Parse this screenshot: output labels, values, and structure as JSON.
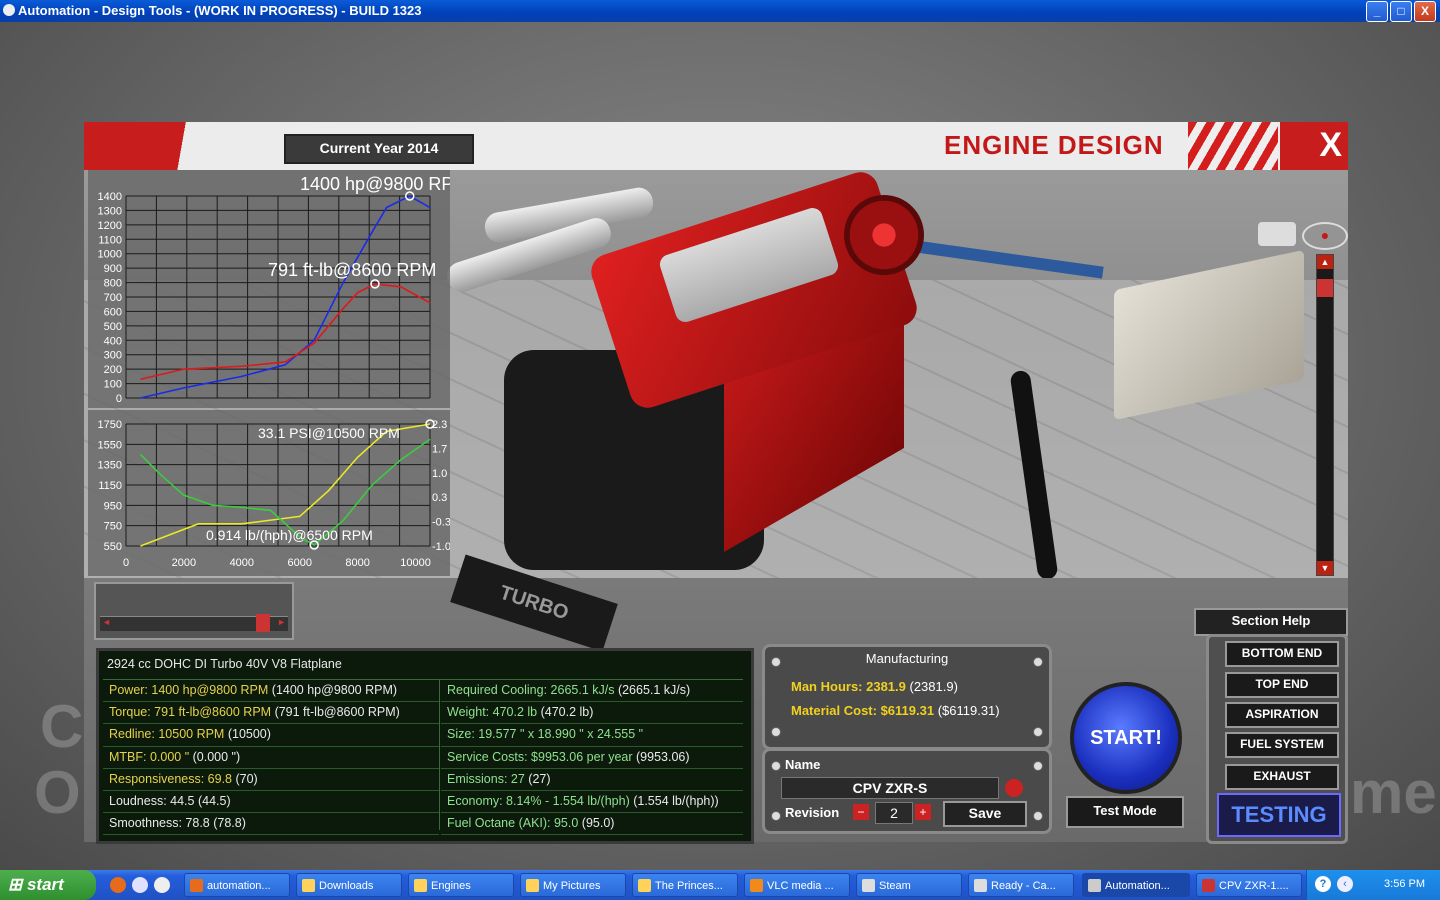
{
  "window": {
    "title": "Automation - Design Tools - (WORK IN PROGRESS) - BUILD 1323",
    "min": "_",
    "max": "□",
    "close": "X"
  },
  "background_text": {
    "left_top": "C",
    "left_bottom": "O",
    "right": "me"
  },
  "header": {
    "year": "Current Year 2014",
    "title": "ENGINE DESIGN",
    "close": "X"
  },
  "viewport_decor": {
    "turbo_label": "TURBO"
  },
  "chart_data": [
    {
      "type": "line",
      "title": "",
      "annotations": [
        "1400 hp@9800 RPM",
        "791 ft-lb@8600 RPM"
      ],
      "y_ticks": [
        "1400",
        "1300",
        "1200",
        "1100",
        "1000",
        "900",
        "800",
        "700",
        "600",
        "500",
        "400",
        "300",
        "200",
        "100",
        "0"
      ],
      "ylim": [
        0,
        1400
      ],
      "xlim": [
        0,
        10500
      ],
      "series": [
        {
          "color": "#1a2be8",
          "x": [
            500,
            2000,
            4000,
            5500,
            6500,
            7500,
            8500,
            9000,
            9800,
            10500
          ],
          "y": [
            0,
            70,
            150,
            230,
            400,
            800,
            1150,
            1320,
            1400,
            1320
          ]
        },
        {
          "color": "#e01818",
          "x": [
            500,
            2000,
            4000,
            5500,
            6500,
            7500,
            8000,
            8600,
            9500,
            10500
          ],
          "y": [
            130,
            200,
            220,
            250,
            380,
            620,
            730,
            791,
            770,
            660
          ]
        }
      ]
    },
    {
      "type": "line",
      "title": "",
      "annotations": [
        "33.1 PSI@10500 RPM",
        "0.914 lb/(hph)@6500 RPM"
      ],
      "y_left_ticks": [
        "1750",
        "1550",
        "1350",
        "1150",
        "950",
        "750",
        "550"
      ],
      "y_right_ticks": [
        "2.3",
        "1.7",
        "1.0",
        "0.3",
        "-0.3",
        "-1.0"
      ],
      "x_ticks": [
        "0",
        "2000",
        "4000",
        "6000",
        "8000",
        "10000"
      ],
      "ylim": [
        550,
        1750
      ],
      "ylim_right": [
        -1.0,
        2.3
      ],
      "xlim": [
        0,
        10500
      ],
      "series": [
        {
          "color": "#e8e82a",
          "axis": "right",
          "x": [
            500,
            1500,
            2500,
            4000,
            5000,
            6000,
            7000,
            8000,
            9000,
            10500
          ],
          "y": [
            -1.0,
            -0.7,
            -0.4,
            -0.4,
            -0.3,
            -0.2,
            0.5,
            1.4,
            2.1,
            2.3
          ]
        },
        {
          "color": "#3ccc3c",
          "axis": "left",
          "x": [
            500,
            1200,
            2000,
            3000,
            4000,
            5000,
            6000,
            6500,
            7500,
            8500,
            9500,
            10500
          ],
          "y": [
            1450,
            1250,
            1050,
            950,
            930,
            900,
            640,
            560,
            800,
            1150,
            1400,
            1600
          ]
        }
      ]
    }
  ],
  "slider": {
    "left": "◄",
    "right": "►"
  },
  "section_help": "Section Help",
  "stats": {
    "header": "2924 cc DOHC DI Turbo 40V V8 Flatplane",
    "left": [
      {
        "k": "Power: 1400 hp@9800 RPM",
        "p": " (1400 hp@9800 RPM)",
        "style": "gold"
      },
      {
        "k": "Torque: 791 ft-lb@8600 RPM",
        "p": " (791 ft-lb@8600 RPM)",
        "style": "gold"
      },
      {
        "k": "Redline: 10500 RPM",
        "p": " (10500)",
        "style": "gold"
      },
      {
        "k": "MTBF: 0.000 \"",
        "p": " (0.000 \")",
        "style": "gold"
      },
      {
        "k": "Responsiveness: 69.8",
        "p": " (70)",
        "style": "gold"
      },
      {
        "k": "Loudness: 44.5",
        "p": " (44.5)",
        "style": "w"
      },
      {
        "k": "Smoothness: 78.8",
        "p": " (78.8)",
        "style": "w"
      }
    ],
    "right": [
      {
        "k": "Required Cooling: 2665.1 kJ/s",
        "p": " (2665.1 kJ/s)",
        "style": "g"
      },
      {
        "k": "Weight: 470.2 lb",
        "p": " (470.2 lb)",
        "style": "g"
      },
      {
        "k": "Size: 19.577 \" x 18.990 \" x 24.555 \"",
        "p": "",
        "style": "g"
      },
      {
        "k": "Service Costs: $9953.06 per year",
        "p": " (9953.06)",
        "style": "g"
      },
      {
        "k": "Emissions: 27",
        "p": " (27)",
        "style": "g"
      },
      {
        "k": "Economy: 8.14% - 1.554 lb/(hph)",
        "p": " (1.554 lb/(hph))",
        "style": "g"
      },
      {
        "k": "Fuel Octane (AKI): 95.0",
        "p": " (95.0)",
        "style": "g"
      }
    ]
  },
  "manufacturing": {
    "title": "Manufacturing",
    "man_hours_label": "Man Hours: 2381.9",
    "man_hours_paren": " (2381.9)",
    "material_label": "Material Cost: $6119.31",
    "material_paren": " ($6119.31)"
  },
  "name_panel": {
    "name_label": "Name",
    "name_value": "CPV ZXR-S",
    "revision_label": "Revision",
    "revision_value": "2",
    "minus": "−",
    "plus": "+",
    "save": "Save"
  },
  "start": "START!",
  "test_mode": "Test Mode",
  "sections": [
    "BOTTOM END",
    "TOP END",
    "ASPIRATION",
    "FUEL SYSTEM",
    "EXHAUST"
  ],
  "testing": "TESTING",
  "taskbar": {
    "start": "start",
    "tasks": [
      "automation...",
      "Downloads",
      "Engines",
      "My Pictures",
      "The Princes...",
      "VLC media ...",
      "Steam",
      "Ready - Ca...",
      "Automation...",
      "CPV ZXR-1...."
    ],
    "clock": "3:56 PM"
  }
}
